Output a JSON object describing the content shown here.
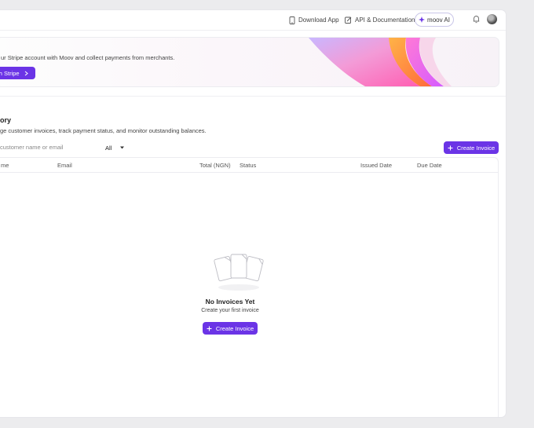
{
  "topbar": {
    "download_label": "Download App",
    "api_label": "API & Documentation",
    "ai_label": "moov AI"
  },
  "banner": {
    "text": "ur Stripe account with Moov and collect payments from merchants.",
    "button_label": "ith Stripe"
  },
  "invoices": {
    "title": "ory",
    "subtitle": "ge customer invoices, track payment status, and monitor outstanding balances.",
    "search_placeholder": "customer name or email",
    "filter_value": "All",
    "create_label": "Create Invoice",
    "columns": [
      "me",
      "Email",
      "Total (NGN)",
      "Status",
      "Issued Date",
      "Due Date"
    ],
    "rows": [],
    "empty_title": "No Invoices Yet",
    "empty_subtitle": "Create your first invoice",
    "empty_button_label": "Create Invoice"
  },
  "colors": {
    "accent": "#6b34e6"
  }
}
